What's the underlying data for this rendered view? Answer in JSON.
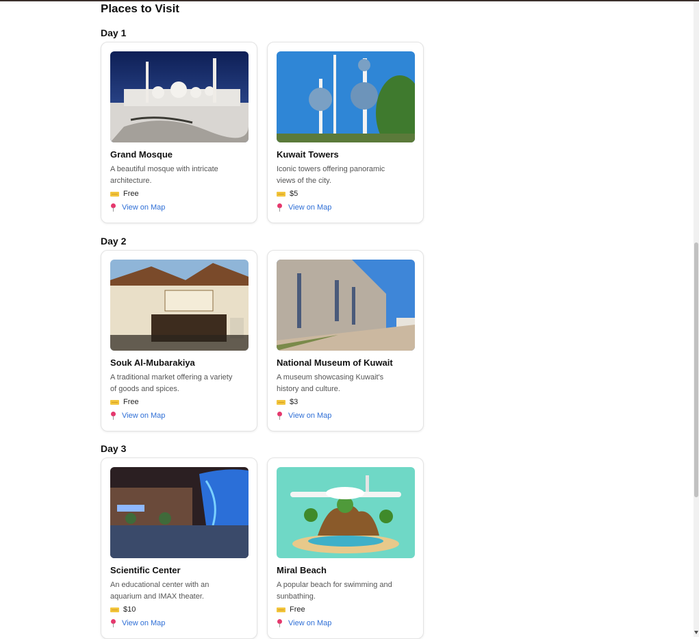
{
  "page": {
    "title": "Places to Visit"
  },
  "days": [
    {
      "label": "Day 1",
      "places": [
        {
          "name": "Grand Mosque",
          "description": "A beautiful mosque with intricate architecture.",
          "price": "Free",
          "map_link": "View on Map"
        },
        {
          "name": "Kuwait Towers",
          "description": "Iconic towers offering panoramic views of the city.",
          "price": "$5",
          "map_link": "View on Map"
        }
      ]
    },
    {
      "label": "Day 2",
      "places": [
        {
          "name": "Souk Al-Mubarakiya",
          "description": "A traditional market offering a variety of goods and spices.",
          "price": "Free",
          "map_link": "View on Map"
        },
        {
          "name": "National Museum of Kuwait",
          "description": "A museum showcasing Kuwait's history and culture.",
          "price": "$3",
          "map_link": "View on Map"
        }
      ]
    },
    {
      "label": "Day 3",
      "places": [
        {
          "name": "Scientific Center",
          "description": "An educational center with an aquarium and IMAX theater.",
          "price": "$10",
          "map_link": "View on Map"
        },
        {
          "name": "Miral Beach",
          "description": "A popular beach for swimming and sunbathing.",
          "price": "Free",
          "map_link": "View on Map"
        }
      ]
    }
  ],
  "icons": {
    "price": "ticket-icon",
    "map": "map-pin-icon"
  },
  "colors": {
    "link": "#2f6fd6",
    "pin": "#e5386d",
    "ticket": "#f2c53d"
  }
}
